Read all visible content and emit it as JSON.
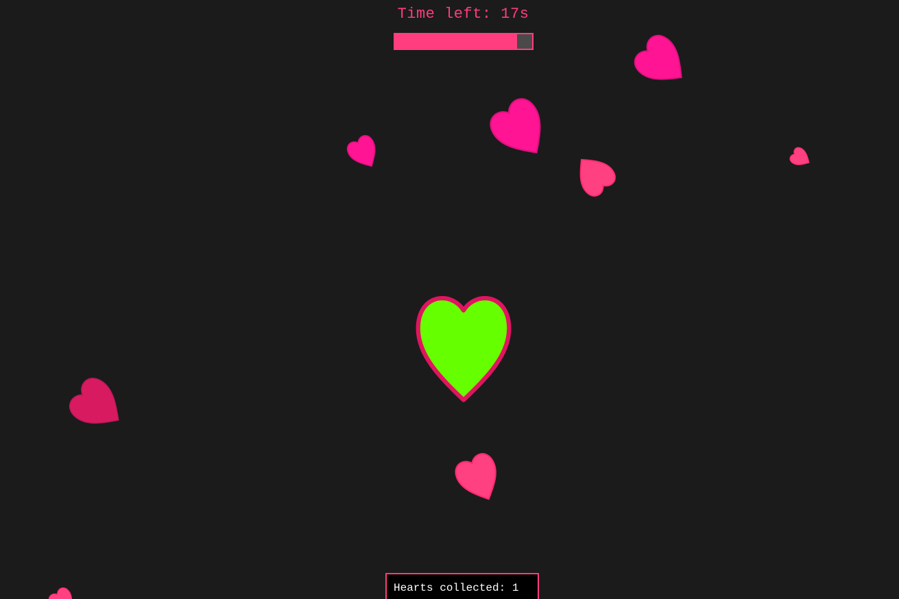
{
  "hud": {
    "timer_text": "Time left: 17s",
    "time_remaining_fraction": 0.89,
    "hearts_collected_text": "Hearts collected: 1"
  },
  "colors": {
    "background": "#1b1b1b",
    "accent": "#ff3d7f",
    "timer_track": "#4a4a4a",
    "player_fill": "#66ff00",
    "player_stroke": "#e0155f",
    "heart_hot_pink": "#ff1493",
    "heart_pink": "#ff4081",
    "heart_crimson": "#d81b60"
  },
  "player": {
    "icon": "heart-icon"
  },
  "falling_hearts": [
    {
      "color": "heart_hot_pink"
    },
    {
      "color": "heart_hot_pink"
    },
    {
      "color": "heart_hot_pink"
    },
    {
      "color": "heart_pink"
    },
    {
      "color": "heart_pink"
    },
    {
      "color": "heart_crimson"
    },
    {
      "color": "heart_pink"
    },
    {
      "color": "heart_pink"
    }
  ]
}
